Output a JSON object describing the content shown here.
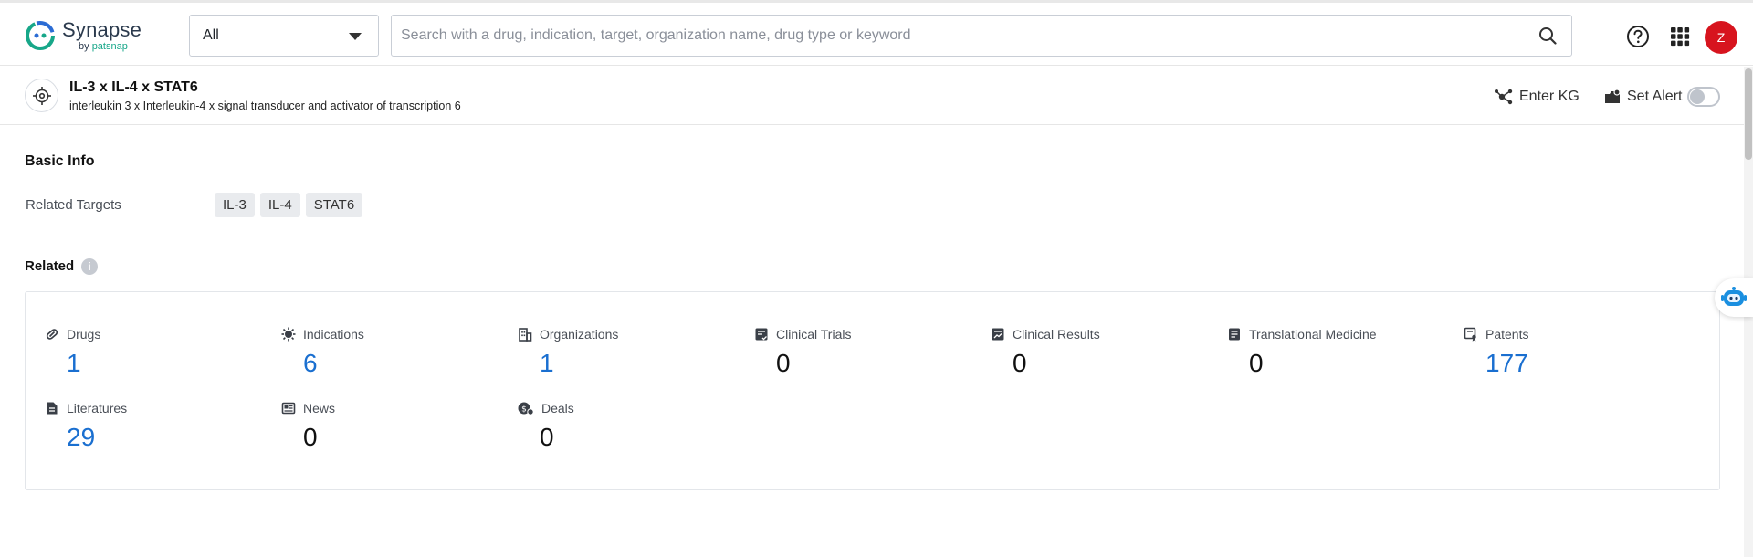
{
  "header": {
    "logo_title": "Synapse",
    "logo_by": "by ",
    "logo_brand": "patsnap",
    "scope_select": "All",
    "search_placeholder": "Search with a drug, indication, target, organization name, drug type or keyword",
    "avatar_initial": "Z"
  },
  "target": {
    "title": "IL-3 x IL-4 x STAT6",
    "subtitle": "interleukin 3 x Interleukin-4 x signal transducer and activator of transcription 6",
    "enter_kg": "Enter KG",
    "set_alert": "Set Alert",
    "alert_enabled": false
  },
  "basic_info": {
    "title": "Basic Info",
    "related_targets_label": "Related Targets",
    "related_targets": [
      "IL-3",
      "IL-4",
      "STAT6"
    ]
  },
  "related": {
    "title": "Related",
    "items": [
      {
        "label": "Drugs",
        "value": "1",
        "icon": "pill-icon",
        "link": true
      },
      {
        "label": "Indications",
        "value": "6",
        "icon": "virus-icon",
        "link": true
      },
      {
        "label": "Organizations",
        "value": "1",
        "icon": "building-icon",
        "link": true
      },
      {
        "label": "Clinical Trials",
        "value": "0",
        "icon": "clipboard-icon",
        "link": false
      },
      {
        "label": "Clinical Results",
        "value": "0",
        "icon": "chart-doc-icon",
        "link": false
      },
      {
        "label": "Translational Medicine",
        "value": "0",
        "icon": "book-icon",
        "link": false
      },
      {
        "label": "Patents",
        "value": "177",
        "icon": "patent-icon",
        "link": true
      },
      {
        "label": "Literatures",
        "value": "29",
        "icon": "document-icon",
        "link": true
      },
      {
        "label": "News",
        "value": "0",
        "icon": "newspaper-icon",
        "link": false
      },
      {
        "label": "Deals",
        "value": "0",
        "icon": "deal-icon",
        "link": false
      }
    ]
  },
  "colors": {
    "link_blue": "#1a6fd0",
    "avatar_red": "#d7141e",
    "brand_teal": "#17a789"
  }
}
